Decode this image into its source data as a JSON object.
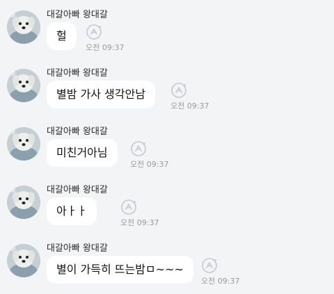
{
  "messages": [
    {
      "sender": "대갈아빠 왕대갈",
      "text": "헐",
      "time": "오전 09:37"
    },
    {
      "sender": "대갈아빠 왕대갈",
      "text": "별밤 가사 생각안남",
      "time": "오전 09:37"
    },
    {
      "sender": "대갈아빠 왕대갈",
      "text": "미친거아님",
      "time": "오전 09:37"
    },
    {
      "sender": "대갈아빠 왕대갈",
      "text": "아ㅏㅏ",
      "time": "오전 09:37"
    },
    {
      "sender": "대갈아빠 왕대갈",
      "text": "별이 가득히 뜨는밤ㅁ~~~",
      "time": "오전 09:37"
    }
  ],
  "icons": {
    "avatar": "white-dog-profile-photo",
    "reply": "circle-arrow-reply-icon"
  },
  "colors": {
    "background": "#f3f4f6",
    "bubble": "#ffffff",
    "time_text": "#9a9a9a"
  }
}
